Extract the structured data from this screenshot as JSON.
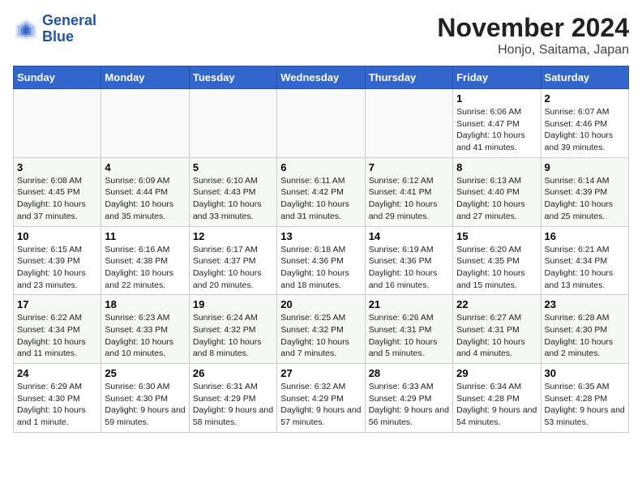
{
  "logo": {
    "line1": "General",
    "line2": "Blue"
  },
  "title": "November 2024",
  "location": "Honjo, Saitama, Japan",
  "days_of_week": [
    "Sunday",
    "Monday",
    "Tuesday",
    "Wednesday",
    "Thursday",
    "Friday",
    "Saturday"
  ],
  "weeks": [
    [
      {
        "day": "",
        "info": ""
      },
      {
        "day": "",
        "info": ""
      },
      {
        "day": "",
        "info": ""
      },
      {
        "day": "",
        "info": ""
      },
      {
        "day": "",
        "info": ""
      },
      {
        "day": "1",
        "info": "Sunrise: 6:06 AM\nSunset: 4:47 PM\nDaylight: 10 hours and 41 minutes."
      },
      {
        "day": "2",
        "info": "Sunrise: 6:07 AM\nSunset: 4:46 PM\nDaylight: 10 hours and 39 minutes."
      }
    ],
    [
      {
        "day": "3",
        "info": "Sunrise: 6:08 AM\nSunset: 4:45 PM\nDaylight: 10 hours and 37 minutes."
      },
      {
        "day": "4",
        "info": "Sunrise: 6:09 AM\nSunset: 4:44 PM\nDaylight: 10 hours and 35 minutes."
      },
      {
        "day": "5",
        "info": "Sunrise: 6:10 AM\nSunset: 4:43 PM\nDaylight: 10 hours and 33 minutes."
      },
      {
        "day": "6",
        "info": "Sunrise: 6:11 AM\nSunset: 4:42 PM\nDaylight: 10 hours and 31 minutes."
      },
      {
        "day": "7",
        "info": "Sunrise: 6:12 AM\nSunset: 4:41 PM\nDaylight: 10 hours and 29 minutes."
      },
      {
        "day": "8",
        "info": "Sunrise: 6:13 AM\nSunset: 4:40 PM\nDaylight: 10 hours and 27 minutes."
      },
      {
        "day": "9",
        "info": "Sunrise: 6:14 AM\nSunset: 4:39 PM\nDaylight: 10 hours and 25 minutes."
      }
    ],
    [
      {
        "day": "10",
        "info": "Sunrise: 6:15 AM\nSunset: 4:39 PM\nDaylight: 10 hours and 23 minutes."
      },
      {
        "day": "11",
        "info": "Sunrise: 6:16 AM\nSunset: 4:38 PM\nDaylight: 10 hours and 22 minutes."
      },
      {
        "day": "12",
        "info": "Sunrise: 6:17 AM\nSunset: 4:37 PM\nDaylight: 10 hours and 20 minutes."
      },
      {
        "day": "13",
        "info": "Sunrise: 6:18 AM\nSunset: 4:36 PM\nDaylight: 10 hours and 18 minutes."
      },
      {
        "day": "14",
        "info": "Sunrise: 6:19 AM\nSunset: 4:36 PM\nDaylight: 10 hours and 16 minutes."
      },
      {
        "day": "15",
        "info": "Sunrise: 6:20 AM\nSunset: 4:35 PM\nDaylight: 10 hours and 15 minutes."
      },
      {
        "day": "16",
        "info": "Sunrise: 6:21 AM\nSunset: 4:34 PM\nDaylight: 10 hours and 13 minutes."
      }
    ],
    [
      {
        "day": "17",
        "info": "Sunrise: 6:22 AM\nSunset: 4:34 PM\nDaylight: 10 hours and 11 minutes."
      },
      {
        "day": "18",
        "info": "Sunrise: 6:23 AM\nSunset: 4:33 PM\nDaylight: 10 hours and 10 minutes."
      },
      {
        "day": "19",
        "info": "Sunrise: 6:24 AM\nSunset: 4:32 PM\nDaylight: 10 hours and 8 minutes."
      },
      {
        "day": "20",
        "info": "Sunrise: 6:25 AM\nSunset: 4:32 PM\nDaylight: 10 hours and 7 minutes."
      },
      {
        "day": "21",
        "info": "Sunrise: 6:26 AM\nSunset: 4:31 PM\nDaylight: 10 hours and 5 minutes."
      },
      {
        "day": "22",
        "info": "Sunrise: 6:27 AM\nSunset: 4:31 PM\nDaylight: 10 hours and 4 minutes."
      },
      {
        "day": "23",
        "info": "Sunrise: 6:28 AM\nSunset: 4:30 PM\nDaylight: 10 hours and 2 minutes."
      }
    ],
    [
      {
        "day": "24",
        "info": "Sunrise: 6:29 AM\nSunset: 4:30 PM\nDaylight: 10 hours and 1 minute."
      },
      {
        "day": "25",
        "info": "Sunrise: 6:30 AM\nSunset: 4:30 PM\nDaylight: 9 hours and 59 minutes."
      },
      {
        "day": "26",
        "info": "Sunrise: 6:31 AM\nSunset: 4:29 PM\nDaylight: 9 hours and 58 minutes."
      },
      {
        "day": "27",
        "info": "Sunrise: 6:32 AM\nSunset: 4:29 PM\nDaylight: 9 hours and 57 minutes."
      },
      {
        "day": "28",
        "info": "Sunrise: 6:33 AM\nSunset: 4:29 PM\nDaylight: 9 hours and 56 minutes."
      },
      {
        "day": "29",
        "info": "Sunrise: 6:34 AM\nSunset: 4:28 PM\nDaylight: 9 hours and 54 minutes."
      },
      {
        "day": "30",
        "info": "Sunrise: 6:35 AM\nSunset: 4:28 PM\nDaylight: 9 hours and 53 minutes."
      }
    ]
  ]
}
